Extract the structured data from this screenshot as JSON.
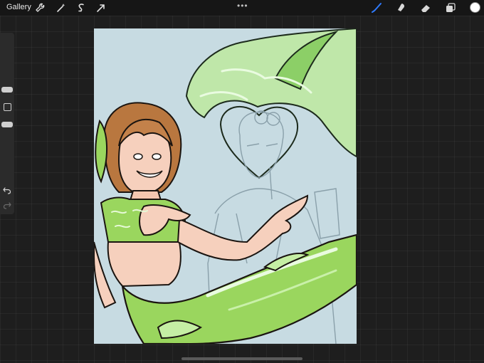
{
  "topbar": {
    "gallery_label": "Gallery",
    "left_tools": [
      "wrench-icon",
      "magic-wand-icon",
      "selection-icon",
      "transform-icon"
    ],
    "more_label": "•••",
    "right_tools": [
      "brush-icon",
      "smudge-icon",
      "eraser-icon",
      "layers-icon"
    ],
    "active_tool": "brush-icon",
    "current_color": "#ffffff"
  },
  "sidebar": {
    "tools": [
      "brush-size-slider",
      "modify-button",
      "opacity-slider",
      "undo-icon",
      "redo-icon"
    ]
  },
  "canvas": {
    "artwork": "merman-illustration"
  },
  "colors": {
    "accent": "#2f7bff",
    "canvas_bg": "#c7dbe2",
    "tail_green": "#9ad65e"
  }
}
